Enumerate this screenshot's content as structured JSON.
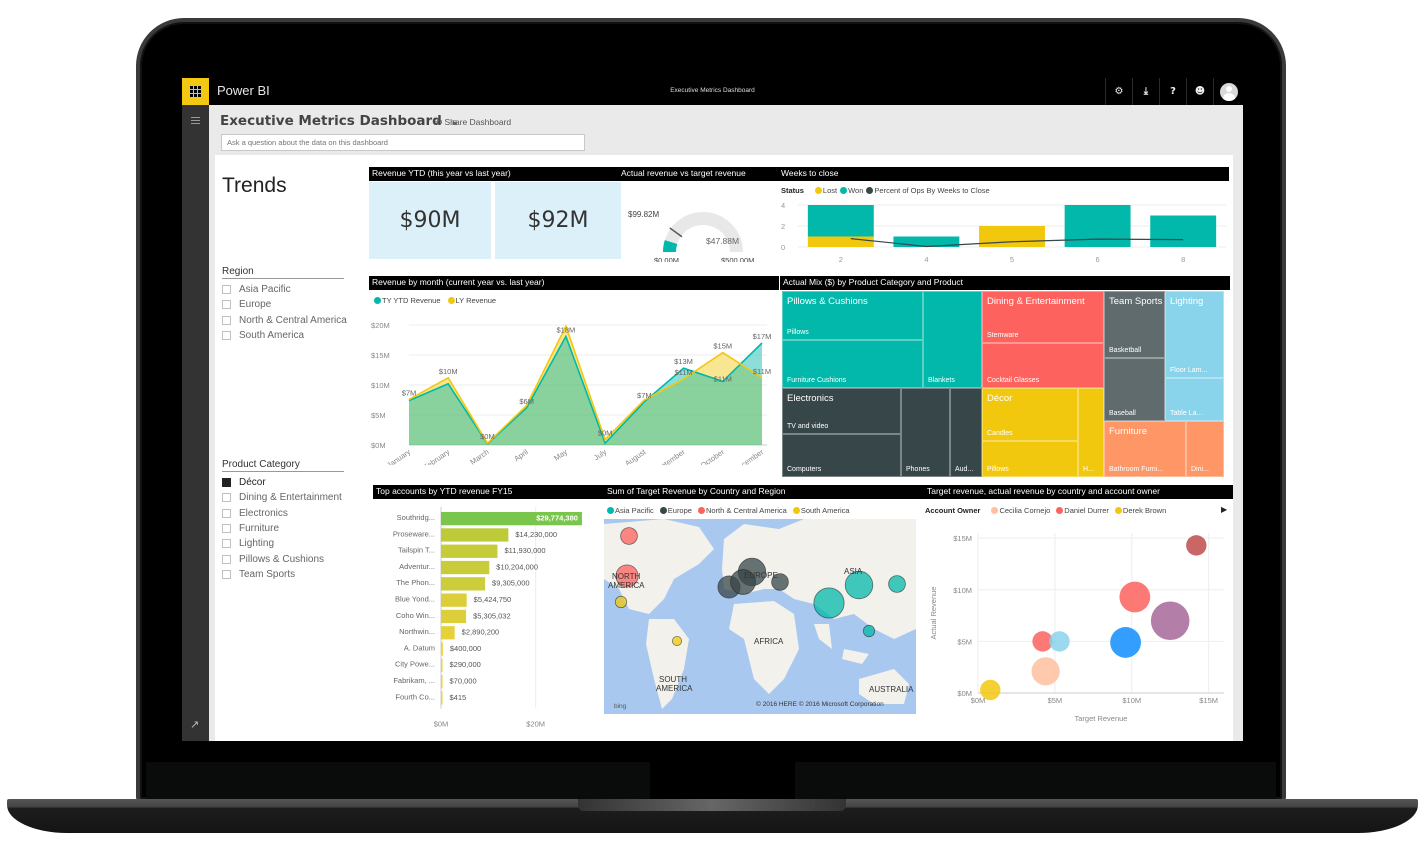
{
  "app": {
    "brand": "Power BI",
    "window_title": "Executive Metrics Dashboard",
    "top_icons": [
      {
        "name": "settings",
        "glyph": "⚙"
      },
      {
        "name": "download",
        "glyph": "⤓"
      },
      {
        "name": "help",
        "glyph": "?"
      },
      {
        "name": "feedback",
        "glyph": "☻"
      }
    ]
  },
  "header": {
    "title": "Executive Metrics Dashboard",
    "share_label": "Share Dashboard",
    "qa_placeholder": "Ask a question about the data on this dashboard"
  },
  "sidebar": {
    "title": "Trends",
    "region_slicer": {
      "title": "Region",
      "items": [
        {
          "label": "Asia Pacific",
          "checked": false
        },
        {
          "label": "Europe",
          "checked": false
        },
        {
          "label": "North & Central America",
          "checked": false
        },
        {
          "label": "South America",
          "checked": false
        }
      ]
    },
    "product_slicer": {
      "title": "Product Category",
      "items": [
        {
          "label": "Décor",
          "checked": true
        },
        {
          "label": "Dining & Entertainment",
          "checked": false
        },
        {
          "label": "Electronics",
          "checked": false
        },
        {
          "label": "Furniture",
          "checked": false
        },
        {
          "label": "Lighting",
          "checked": false
        },
        {
          "label": "Pillows & Cushions",
          "checked": false
        },
        {
          "label": "Team Sports",
          "checked": false
        }
      ]
    }
  },
  "tiles": {
    "revenue_ytd": {
      "title": "Revenue YTD (this year vs last year)",
      "this_year": "$90M",
      "last_year": "$92M"
    },
    "gauge": {
      "title": "Actual revenue vs target revenue",
      "value": 47.88,
      "value_label": "$47.88M",
      "target": 99.82,
      "target_label": "$99.82M",
      "min": 0,
      "min_label": "$0.00M",
      "max": 500,
      "max_label": "$500.00M"
    },
    "weeks_to_close": {
      "title": "Weeks to close",
      "legend_title": "Status",
      "legend": [
        {
          "label": "Lost",
          "color": "#f2c80f"
        },
        {
          "label": "Won",
          "color": "#01b8aa"
        },
        {
          "label": "Percent of Ops By Weeks to Close",
          "color": "#374649"
        }
      ]
    },
    "revenue_by_month": {
      "title": "Revenue by month (current year vs. last year)",
      "legend": [
        {
          "label": "TY YTD Revenue",
          "color": "#01b8aa"
        },
        {
          "label": "LY Revenue",
          "color": "#f2c80f"
        }
      ]
    },
    "treemap": {
      "title": "Actual Mix ($) by Product Category and Product",
      "cells": [
        {
          "category": "Pillows & Cushions",
          "product": "Pillows",
          "color": "#01b8aa"
        },
        {
          "category": "",
          "product": "Furniture Cushions",
          "color": "#01b8aa"
        },
        {
          "category": "",
          "product": "Blankets",
          "color": "#01b8aa"
        },
        {
          "category": "Electronics",
          "product": "TV and video",
          "color": "#374649"
        },
        {
          "category": "",
          "product": "Computers",
          "color": "#374649"
        },
        {
          "category": "",
          "product": "Phones",
          "color": "#374649"
        },
        {
          "category": "",
          "product": "Aud...",
          "color": "#374649"
        },
        {
          "category": "Dining & Entertainment",
          "product": "Stemware",
          "color": "#fd625e"
        },
        {
          "category": "",
          "product": "Cocktail Glasses",
          "color": "#fd625e"
        },
        {
          "category": "Décor",
          "product": "Candles",
          "color": "#f2c80f"
        },
        {
          "category": "",
          "product": "Pillows",
          "color": "#f2c80f"
        },
        {
          "category": "",
          "product": "H...",
          "color": "#f2c80f"
        },
        {
          "category": "Team Sports",
          "product": "Basketball",
          "color": "#5f6b6d"
        },
        {
          "category": "",
          "product": "Baseball",
          "color": "#5f6b6d"
        },
        {
          "category": "Lighting",
          "product": "Floor Lam...",
          "color": "#8ad4eb"
        },
        {
          "category": "",
          "product": "Table La...",
          "color": "#8ad4eb"
        },
        {
          "category": "Furniture",
          "product": "Bathroom Furni...",
          "color": "#fe9666"
        },
        {
          "category": "",
          "product": "Dini...",
          "color": "#fe9666"
        }
      ]
    },
    "top_accounts": {
      "title": "Top accounts by YTD revenue FY15"
    },
    "map": {
      "title": "Sum of Target Revenue by Country and Region",
      "legend": [
        {
          "label": "Asia Pacific",
          "color": "#01b8aa"
        },
        {
          "label": "Europe",
          "color": "#374649"
        },
        {
          "label": "North & Central America",
          "color": "#fd625e"
        },
        {
          "label": "South America",
          "color": "#f2c80f"
        }
      ],
      "labels": [
        "NORTH AMERICA",
        "EUROPE",
        "ASIA",
        "AFRICA",
        "SOUTH AMERICA",
        "AUSTRALIA"
      ],
      "attribution": "© 2016 HERE   © 2016 Microsoft Corporation",
      "bing": "bing",
      "bubbles": [
        {
          "region": "North & Central America",
          "size": 2
        },
        {
          "region": "North & Central America",
          "size": 3
        },
        {
          "region": "South America",
          "size": 1
        },
        {
          "region": "South America",
          "size": 0.6
        },
        {
          "region": "Europe",
          "size": 4
        },
        {
          "region": "Europe",
          "size": 3
        },
        {
          "region": "Europe",
          "size": 3.5
        },
        {
          "region": "Europe",
          "size": 2
        },
        {
          "region": "Asia Pacific",
          "size": 4
        },
        {
          "region": "Asia Pacific",
          "size": 4.5
        },
        {
          "region": "Asia Pacific",
          "size": 2
        },
        {
          "region": "Asia Pacific",
          "size": 1
        }
      ]
    },
    "scatter": {
      "title": "Target revenue, actual revenue by country and account owner",
      "legend_title": "Account Owner",
      "legend": [
        {
          "label": "Cecilia Cornejo",
          "color": "#ffbfa0"
        },
        {
          "label": "Daniel Durrer",
          "color": "#fd625e"
        },
        {
          "label": "Derek Brown",
          "color": "#f2c80f"
        }
      ]
    }
  },
  "chart_data": [
    {
      "type": "bar",
      "title": "Weeks to close",
      "categories": [
        "2",
        "4",
        "5",
        "6",
        "8"
      ],
      "series": [
        {
          "name": "Lost",
          "values": [
            1,
            0,
            2,
            0,
            0
          ],
          "color": "#f2c80f"
        },
        {
          "name": "Won",
          "values": [
            3,
            1,
            0,
            4,
            3
          ],
          "color": "#01b8aa"
        },
        {
          "name": "Percent of Ops By Weeks to Close",
          "type": "line",
          "values": [
            0.8,
            0.05,
            0.5,
            0.75,
            0.7
          ],
          "color": "#374649"
        }
      ],
      "yticks": [
        "0",
        "2",
        "4"
      ],
      "ylim": [
        0,
        4.5
      ],
      "stacked": true
    },
    {
      "type": "area",
      "title": "Revenue by month (current year vs. last year)",
      "categories": [
        "January",
        "February",
        "March",
        "April",
        "May",
        "July",
        "August",
        "September",
        "October",
        "December"
      ],
      "series": [
        {
          "name": "TY YTD Revenue",
          "values": [
            7.4,
            10.2,
            0.2,
            6.2,
            18.1,
            0.3,
            7.2,
            12.8,
            10.6,
            17.0
          ],
          "color": "#01b8aa",
          "labels": [
            "",
            "",
            "",
            "$6M",
            "$18M",
            "",
            "$7M",
            "$13M",
            "$11M",
            "$17M"
          ]
        },
        {
          "name": "LY Revenue",
          "values": [
            7.6,
            11.2,
            0.3,
            6.6,
            19.8,
            0.9,
            7.5,
            11.0,
            15.4,
            11.2
          ],
          "color": "#f2c80f",
          "labels": [
            "$7M",
            "$10M",
            "$0M",
            "",
            "",
            "$0M",
            "",
            "$11M",
            "$15M",
            "$11M"
          ]
        }
      ],
      "yticks": [
        "$0M",
        "$5M",
        "$10M",
        "$15M",
        "$20M"
      ],
      "ylim": [
        0,
        20
      ]
    },
    {
      "type": "bar",
      "title": "Top accounts by YTD revenue FY15",
      "orientation": "horizontal",
      "categories": [
        "Southridg...",
        "Proseware...",
        "Tailspin T...",
        "Adventur...",
        "The Phon...",
        "Blue Yond...",
        "Coho Win...",
        "Northwin...",
        "A. Datum",
        "City Powe...",
        "Fabrikam, ...",
        "Fourth Co..."
      ],
      "values": [
        29774380,
        14230000,
        11930000,
        10204000,
        9305000,
        5424750,
        5305032,
        2890200,
        400000,
        290000,
        70000,
        415
      ],
      "value_labels": [
        "$29,774,380",
        "$14,230,000",
        "$11,930,000",
        "$10,204,000",
        "$9,305,000",
        "$5,424,750",
        "$5,305,032",
        "$2,890,200",
        "$400,000",
        "$290,000",
        "$70,000",
        "$415"
      ],
      "xticks": [
        "$0M",
        "$20M"
      ],
      "xlim": [
        0,
        30000000
      ]
    },
    {
      "type": "scatter",
      "title": "Target revenue, actual revenue by country and account owner",
      "xlabel": "Target Revenue",
      "ylabel": "Actual Revenue",
      "xticks": [
        "$0M",
        "$5M",
        "$10M",
        "$15M"
      ],
      "yticks": [
        "$0M",
        "$5M",
        "$10M",
        "$15M"
      ],
      "xlim": [
        0,
        16
      ],
      "ylim": [
        0,
        15.5
      ],
      "points": [
        {
          "x": 0.8,
          "y": 0.3,
          "size": 2,
          "color": "#f2c80f"
        },
        {
          "x": 4.2,
          "y": 5.0,
          "size": 2,
          "color": "#fd625e"
        },
        {
          "x": 5.3,
          "y": 5.0,
          "size": 2,
          "color": "#8ad4eb"
        },
        {
          "x": 4.4,
          "y": 2.1,
          "size": 3.5,
          "color": "#ffbfa0"
        },
        {
          "x": 9.6,
          "y": 4.9,
          "size": 4,
          "color": "#118dff"
        },
        {
          "x": 10.2,
          "y": 9.3,
          "size": 4,
          "color": "#fd625e"
        },
        {
          "x": 12.5,
          "y": 7.0,
          "size": 5.5,
          "color": "#a66999"
        },
        {
          "x": 14.2,
          "y": 14.3,
          "size": 2,
          "color": "#c04b4b"
        }
      ]
    }
  ]
}
